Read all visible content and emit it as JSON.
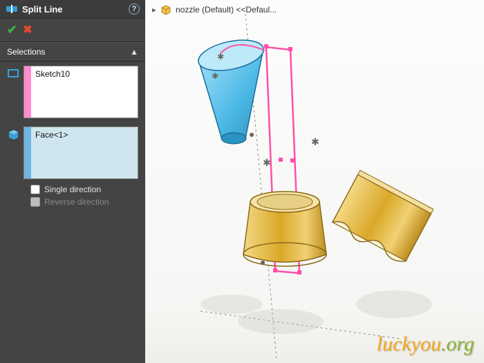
{
  "panel": {
    "title": "Split Line",
    "help_tooltip": "?",
    "ok_label": "✔",
    "cancel_label": "✖",
    "sections": {
      "selections": {
        "title": "Selections",
        "sketch_entry": "Sketch10",
        "face_entry": "Face<1>",
        "single_direction": "Single direction",
        "reverse_direction": "Reverse direction"
      }
    }
  },
  "breadcrumb": {
    "arrow": "▸",
    "part_label": "nozzle (Default) <<Defaul..."
  },
  "watermark": {
    "a": "luckyou",
    "b": ".org"
  },
  "icons": {
    "split_line": "split-line-icon",
    "sketch_sel": "sketch-select-icon",
    "face_sel": "face-select-icon",
    "part": "part-icon",
    "help": "help-icon"
  },
  "colors": {
    "sketch_strip": "#ff8ccf",
    "face_strip": "#6fb6e4",
    "cone_fill": "#6ec8ee",
    "cone_stroke": "#1a6c99",
    "gold_fill": "#e7bb4f",
    "gold_stroke": "#8a6a17",
    "sketch_line": "#ff4fa8",
    "axis": "#777777",
    "reflection": "#bdbdb7"
  }
}
